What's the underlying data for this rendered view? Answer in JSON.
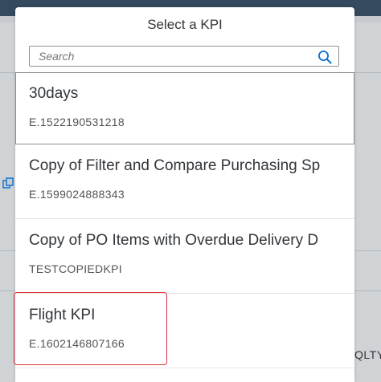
{
  "dialog": {
    "title": "Select a KPI",
    "search": {
      "placeholder": "Search",
      "value": ""
    }
  },
  "items": [
    {
      "title": "30days",
      "subtitle": "E.1522190531218"
    },
    {
      "title": "Copy of Filter and Compare Purchasing Sp",
      "subtitle": "E.1599024888343"
    },
    {
      "title": "Copy of PO Items with Overdue Delivery D",
      "subtitle": "TESTCOPIEDKPI"
    },
    {
      "title": "Flight KPI",
      "subtitle": "E.1602146807166"
    }
  ],
  "background": {
    "edge_text": "QLTY"
  },
  "colors": {
    "accent": "#0a6ed1",
    "highlight": "#e0303a",
    "shell": "#354a5f"
  }
}
